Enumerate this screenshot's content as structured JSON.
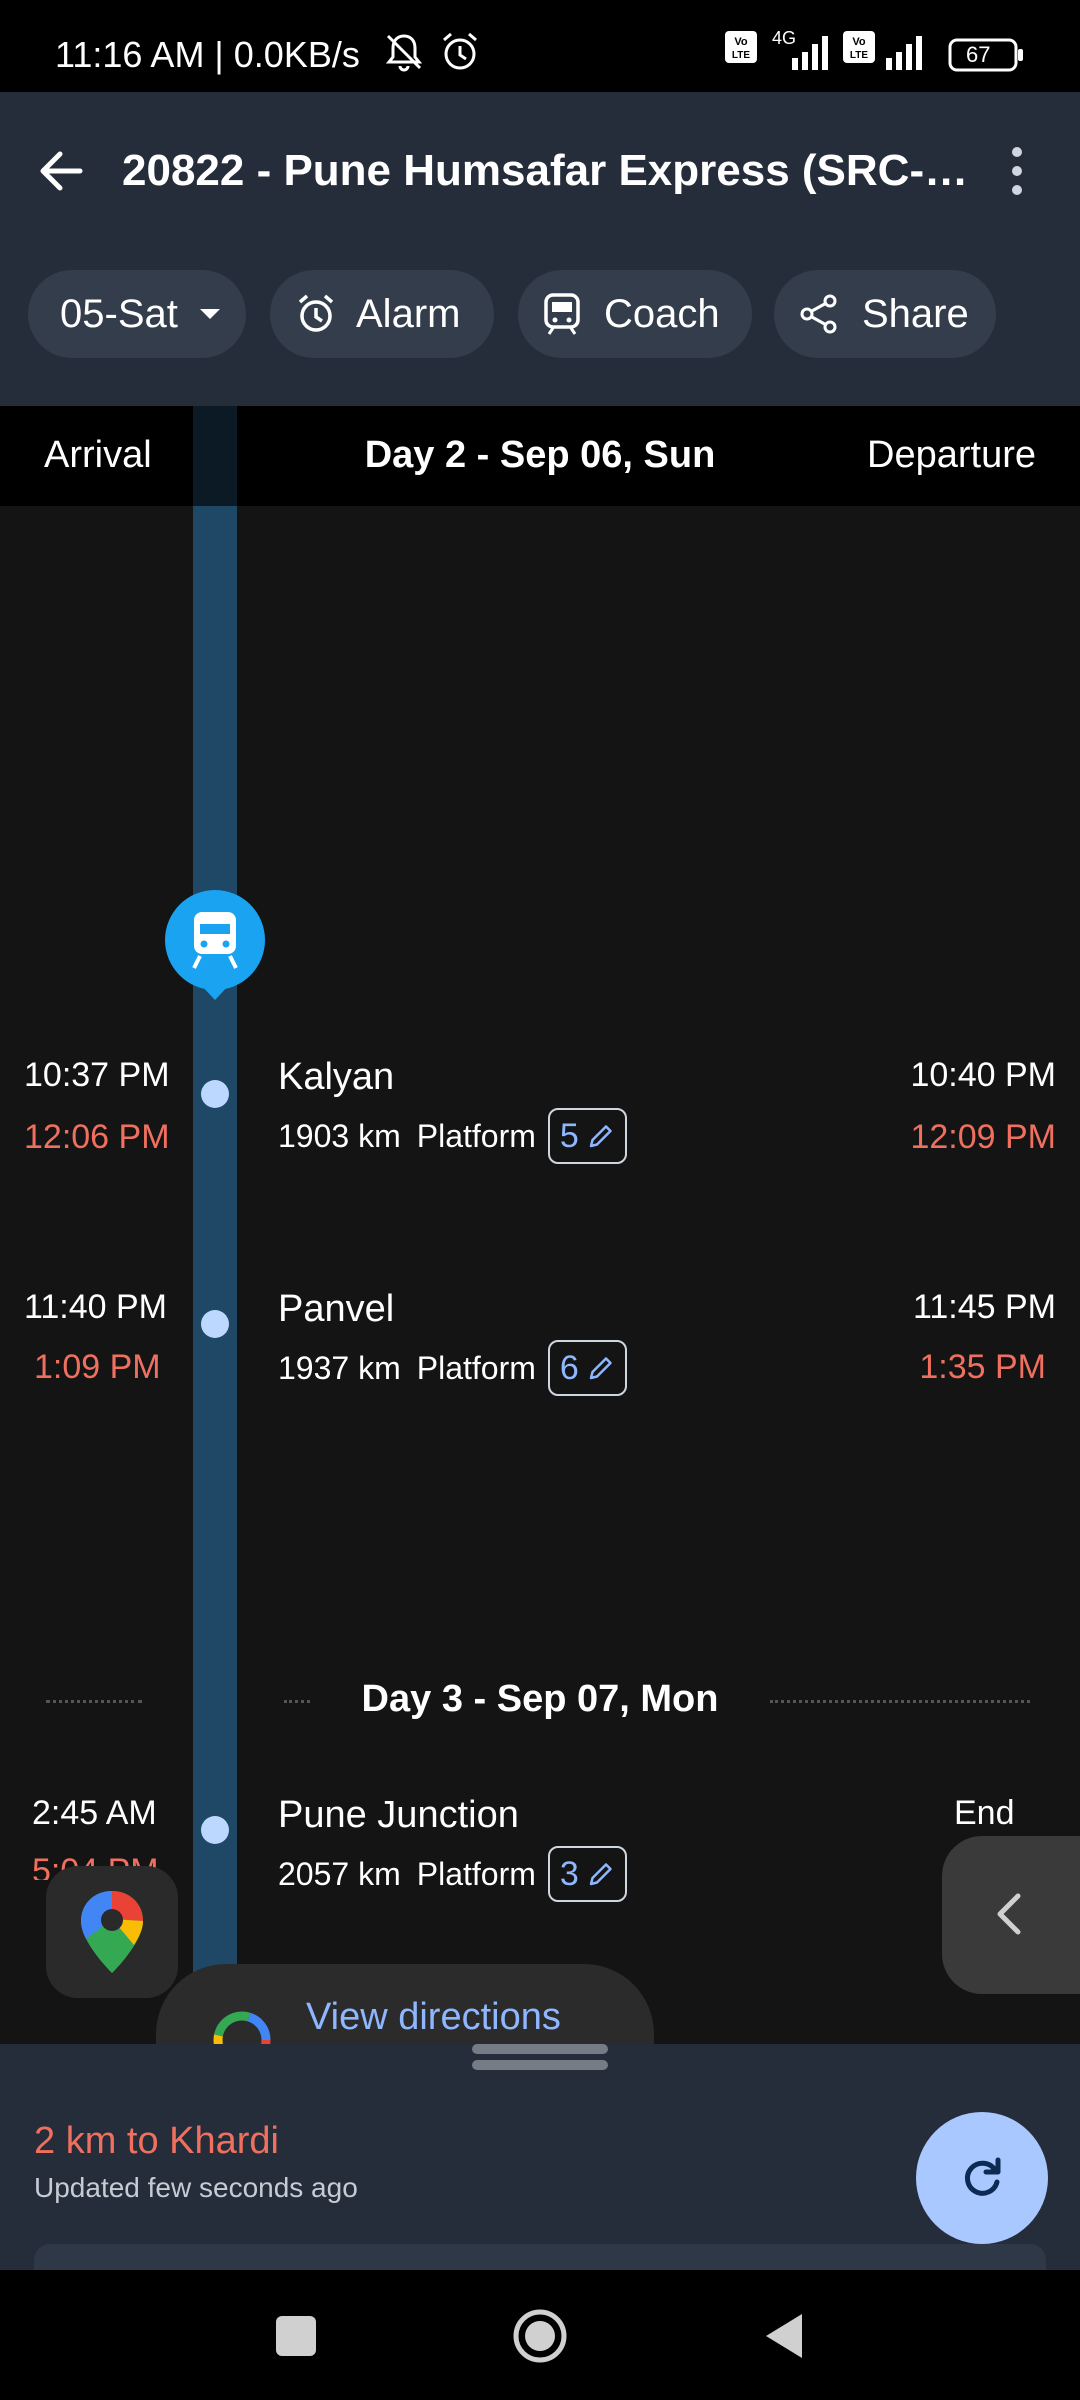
{
  "status_bar": {
    "time_text": "11:16 AM | 0.0KB/s",
    "network": "4G",
    "battery": "67"
  },
  "header": {
    "title": "20822 - Pune Humsafar Express (SRC-P…",
    "chips": {
      "date": "05-Sat",
      "alarm": "Alarm",
      "coach": "Coach",
      "share": "Share"
    }
  },
  "timeline": {
    "arrival_label": "Arrival",
    "departure_label": "Departure",
    "day2_label": "Day 2 - Sep 06, Sun",
    "day3_label": "Day 3 - Sep 07, Mon",
    "stations": [
      {
        "name": "Kalyan",
        "distance": "1903 km",
        "platform_label": "Platform",
        "platform": "5",
        "arrival_sched": "10:37 PM",
        "arrival_actual": "12:06 PM",
        "departure_sched": "10:40 PM",
        "departure_actual": "12:09 PM"
      },
      {
        "name": "Panvel",
        "distance": "1937 km",
        "platform_label": "Platform",
        "platform": "6",
        "arrival_sched": "11:40 PM",
        "arrival_actual": "1:09 PM",
        "departure_sched": "11:45 PM",
        "departure_actual": "1:35 PM"
      },
      {
        "name": "Pune Junction",
        "distance": "2057 km",
        "platform_label": "Platform",
        "platform": "3",
        "arrival_sched": "2:45 AM",
        "arrival_actual": "5:04 PM",
        "departure_sched": "End"
      }
    ]
  },
  "view_directions": "View directions",
  "bottom_sheet": {
    "location": "2 km to Khardi",
    "updated": "Updated few seconds ago"
  },
  "colors": {
    "late": "#f0705f",
    "accent": "#8fb7ff",
    "header_bg": "#252d3a",
    "track": "#1e4866",
    "train_badge": "#1aa3f0"
  }
}
